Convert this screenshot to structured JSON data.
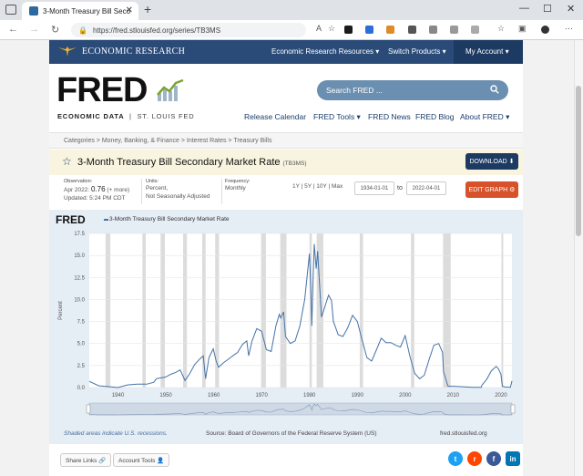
{
  "browser": {
    "tab_title": "3-Month Treasury Bill Secondary",
    "url": "https://fred.stlouisfed.org/series/TB3MS",
    "new_tab": "+",
    "tab_close": "✕",
    "win_min": "—",
    "win_max": "☐",
    "win_close": "✕"
  },
  "topnav": {
    "brand": "ECONOMIC RESEARCH",
    "items": [
      "Economic Research Resources ▾",
      "Switch Products ▾",
      "My Account ▾"
    ]
  },
  "header": {
    "logo": "FRED",
    "subtitle_bold": "ECONOMIC DATA",
    "subtitle_light": "ST. LOUIS FED",
    "search_placeholder": "Search FRED ...",
    "nav": [
      "Release Calendar",
      "FRED Tools ▾",
      "FRED News",
      "FRED Blog",
      "About FRED ▾"
    ]
  },
  "breadcrumb": "Categories > Money, Banking, & Finance > Interest Rates > Treasury Bills",
  "series": {
    "title": "3-Month Treasury Bill Secondary Market Rate",
    "id": "(TB3MS)",
    "download_label": "DOWNLOAD",
    "edit_label": "EDIT GRAPH"
  },
  "meta": {
    "observation_label": "Observation:",
    "observation_date": "Apr 2022:",
    "observation_value": "0.76",
    "observation_more": "(+ more)",
    "updated": "Updated: 5:24 PM CDT",
    "units_label": "Units:",
    "units_1": "Percent,",
    "units_2": "Not Seasonally Adjusted",
    "frequency_label": "Frequency:",
    "frequency": "Monthly",
    "ranges": "1Y | 5Y | 10Y | Max",
    "start_date": "1934-01-01",
    "to": "to",
    "end_date": "2022-04-01"
  },
  "chart_panel": {
    "logo": "FRED",
    "legend": "3-Month Treasury Bill Secondary Market Rate",
    "recession_note": "Shaded areas indicate U.S. recessions.",
    "source": "Source: Board of Governors of the Federal Reserve System (US)",
    "site": "fred.stlouisfed.org"
  },
  "bottom": {
    "share_links": "Share Links 🔗",
    "account_tools": "Account Tools 👤"
  },
  "colors": {
    "navy": "#2a4a78",
    "line": "#4572a7",
    "recession": "#dcdcdc",
    "orange": "#d7512a"
  },
  "chart_data": {
    "type": "line",
    "title": "",
    "xlabel": "",
    "ylabel": "Percent",
    "xlim": [
      1934,
      2022.3
    ],
    "ylim": [
      0,
      17.5
    ],
    "yticks": [
      0.0,
      2.5,
      5.0,
      7.5,
      10.0,
      12.5,
      15.0,
      17.5
    ],
    "xticks": [
      1940,
      1950,
      1960,
      1970,
      1980,
      1990,
      2000,
      2010,
      2020
    ],
    "series": [
      {
        "x": [
          1934,
          1936,
          1938,
          1940,
          1942,
          1944,
          1946,
          1947.5,
          1948,
          1949,
          1950,
          1951,
          1952,
          1953,
          1953.5,
          1954,
          1955,
          1956,
          1957,
          1957.8,
          1958.3,
          1959,
          1959.9,
          1960.5,
          1961,
          1962,
          1963,
          1964,
          1965,
          1966,
          1966.9,
          1967.3,
          1968,
          1969,
          1970,
          1971,
          1972,
          1973,
          1973.7,
          1974,
          1974.6,
          1975,
          1976,
          1977,
          1978,
          1979,
          1980,
          1980.3,
          1980.5,
          1980.8,
          1981,
          1981.4,
          1981.7,
          1982,
          1982.5,
          1983,
          1984,
          1984.6,
          1985,
          1986,
          1987,
          1988,
          1989,
          1990,
          1991,
          1992,
          1993,
          1994,
          1995,
          1996,
          1997,
          1998,
          1999,
          2000,
          2001,
          2002,
          2003,
          2004,
          2005,
          2006,
          2007,
          2007.8,
          2008,
          2008.9,
          2009,
          2010,
          2012,
          2014,
          2015.9,
          2016,
          2017,
          2018,
          2019,
          2019.5,
          2020,
          2020.3,
          2021,
          2022,
          2022.3
        ],
        "values": [
          0.7,
          0.2,
          0.1,
          0.0,
          0.3,
          0.38,
          0.38,
          0.6,
          1.0,
          1.1,
          1.2,
          1.5,
          1.7,
          2.0,
          1.4,
          0.8,
          1.6,
          2.6,
          3.2,
          3.6,
          1.0,
          3.4,
          4.4,
          3.0,
          2.3,
          2.8,
          3.2,
          3.6,
          4.0,
          4.9,
          5.3,
          3.6,
          5.3,
          6.7,
          6.4,
          4.3,
          4.1,
          7.0,
          8.3,
          7.9,
          8.6,
          5.8,
          5.0,
          5.3,
          7.0,
          10.0,
          15.2,
          11.0,
          7.0,
          13.0,
          16.3,
          13.5,
          15.5,
          12.8,
          8.0,
          8.8,
          10.5,
          9.9,
          7.5,
          6.0,
          5.8,
          6.8,
          8.2,
          7.5,
          5.4,
          3.4,
          3.0,
          4.3,
          5.6,
          5.1,
          5.1,
          4.8,
          4.6,
          5.9,
          3.5,
          1.6,
          1.0,
          1.4,
          3.2,
          4.8,
          5.0,
          4.0,
          1.8,
          0.2,
          0.15,
          0.14,
          0.09,
          0.03,
          0.02,
          0.25,
          0.9,
          1.9,
          2.4,
          2.1,
          1.5,
          0.14,
          0.05,
          0.04,
          0.76
        ]
      }
    ],
    "recessions": [
      [
        1937.4,
        1938.4
      ],
      [
        1945.1,
        1945.8
      ],
      [
        1948.9,
        1949.8
      ],
      [
        1953.6,
        1954.4
      ],
      [
        1957.6,
        1958.3
      ],
      [
        1960.3,
        1961.1
      ],
      [
        1969.9,
        1970.9
      ],
      [
        1973.9,
        1975.2
      ],
      [
        1980.0,
        1980.5
      ],
      [
        1981.5,
        1982.9
      ],
      [
        1990.5,
        1991.2
      ],
      [
        2001.2,
        2001.9
      ],
      [
        2007.9,
        2009.5
      ],
      [
        2020.1,
        2020.3
      ]
    ]
  }
}
